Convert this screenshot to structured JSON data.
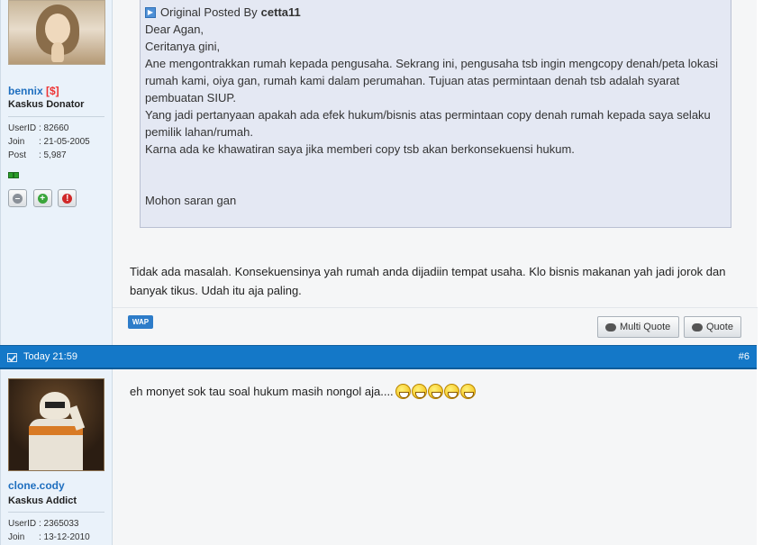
{
  "post1": {
    "author": {
      "name": "bennix",
      "tag": "[$]",
      "rank": "Kaskus Donator",
      "userid_label": "UserID",
      "userid": ": 82660",
      "join_label": "Join",
      "join": ": 21-05-2005",
      "post_label": "Post",
      "post": ": 5,987"
    },
    "quote": {
      "prefix": "Original Posted By",
      "author": "cetta11",
      "lines": [
        "Dear Agan,",
        "",
        "Ceritanya gini,",
        "Ane mengontrakkan rumah kepada pengusaha. Sekrang ini, pengusaha tsb ingin mengcopy denah/peta lokasi",
        "rumah kami, oiya gan, rumah kami dalam perumahan. Tujuan atas permintaan denah tsb adalah syarat",
        "pembuatan SIUP.",
        "Yang jadi pertanyaan apakah ada efek hukum/bisnis atas permintaan copy denah rumah kepada saya selaku",
        "pemilik lahan/rumah.",
        "Karna ada ke khawatiran saya jika memberi copy tsb akan berkonsekuensi hukum.",
        "",
        "",
        "Mohon saran gan"
      ]
    },
    "reply": "Tidak ada masalah. Konsekuensinya yah rumah anda dijadiin tempat usaha. Klo bisnis makanan yah jadi jorok dan banyak tikus. Udah itu aja paling.",
    "wap": "WAP",
    "multi_quote": "Multi Quote",
    "quote_btn": "Quote"
  },
  "post2": {
    "time": "Today 21:59",
    "number": "#6",
    "author": {
      "name": "clone.cody",
      "rank": "Kaskus Addict",
      "userid_label": "UserID",
      "userid": ": 2365033",
      "join_label": "Join",
      "join": ": 13-12-2010"
    },
    "reply": "eh monyet sok tau soal hukum masih nongol aja....",
    "smiley_count": 5
  }
}
